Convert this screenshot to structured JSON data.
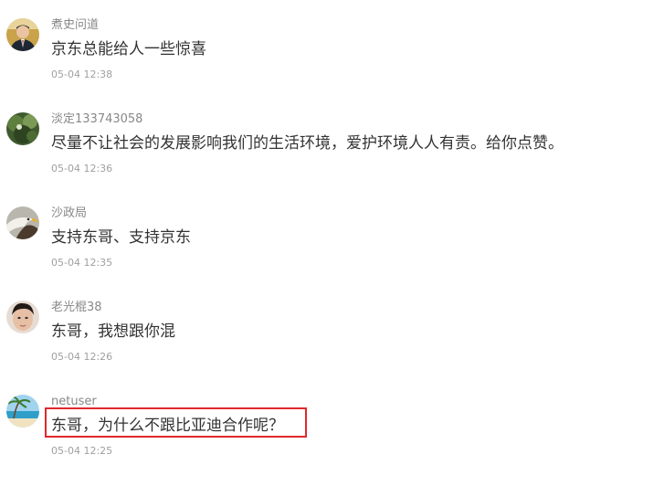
{
  "comments": [
    {
      "username": "煮史问道",
      "content": "京东总能给人一些惊喜",
      "time": "05-04 12:38",
      "avatar_icon": "avatar-man-in-suit"
    },
    {
      "username": "淡定133743058",
      "content": "尽量不让社会的发展影响我们的生活环境，爱护环境人人有责。给你点赞。",
      "time": "05-04 12:36",
      "avatar_icon": "avatar-green-nature"
    },
    {
      "username": "沙政局",
      "content": "支持东哥、支持京东",
      "time": "05-04 12:35",
      "avatar_icon": "avatar-eagle"
    },
    {
      "username": "老光棍38",
      "content": "东哥，我想跟你混",
      "time": "05-04 12:26",
      "avatar_icon": "avatar-young-man"
    },
    {
      "username": "netuser",
      "content": "东哥，为什么不跟比亚迪合作呢？",
      "time": "05-04 12:25",
      "avatar_icon": "avatar-beach",
      "highlighted": true
    }
  ],
  "colors": {
    "username": "#888888",
    "content": "#333333",
    "time": "#a0a0a0",
    "highlight_border": "#e0282c"
  }
}
